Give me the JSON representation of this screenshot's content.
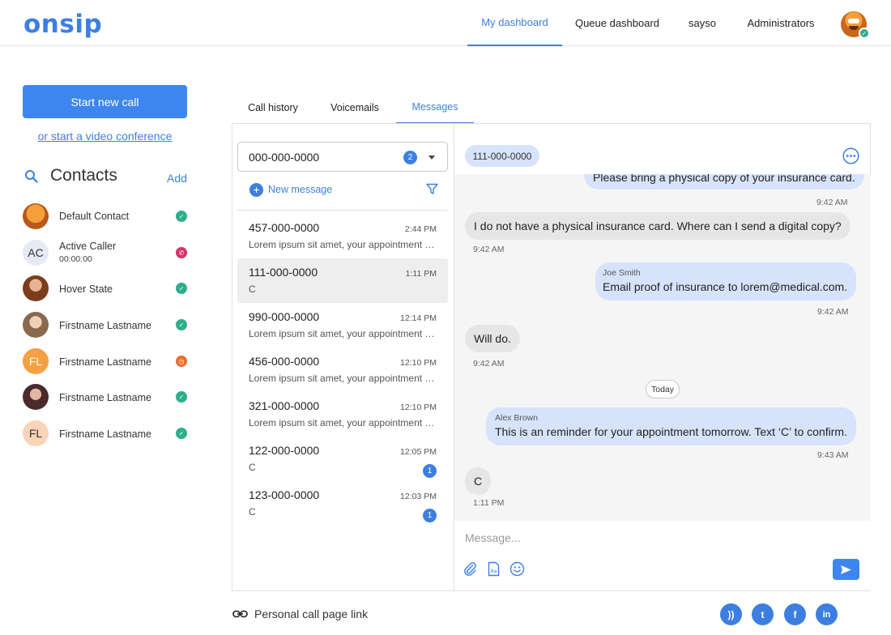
{
  "brand": {
    "logo_text": "onsip",
    "accent": "#3d7fe0"
  },
  "header": {
    "nav": [
      {
        "label": "My dashboard",
        "active": true
      },
      {
        "label": "Queue dashboard",
        "active": false
      },
      {
        "label": "sayso",
        "active": false
      },
      {
        "label": "Administrators",
        "active": false
      }
    ],
    "avatar_status": "available"
  },
  "sidebar": {
    "start_call_label": "Start new call",
    "video_conference_label": "or start a video conference",
    "contacts_title": "Contacts",
    "add_label": "Add",
    "contacts": [
      {
        "name": "Default Contact",
        "sub": "",
        "initials": "",
        "status": "available"
      },
      {
        "name": "Active Caller",
        "sub": "00:00:00",
        "initials": "AC",
        "status": "on-call"
      },
      {
        "name": "Hover State",
        "sub": "",
        "initials": "",
        "status": "available"
      },
      {
        "name": "Firstname Lastname",
        "sub": "",
        "initials": "",
        "status": "available"
      },
      {
        "name": "Firstname Lastname",
        "sub": "",
        "initials": "FL",
        "status": "away"
      },
      {
        "name": "Firstname Lastname",
        "sub": "",
        "initials": "",
        "status": "available"
      },
      {
        "name": "Firstname Lastname",
        "sub": "",
        "initials": "FL",
        "status": "available"
      }
    ]
  },
  "tabs": [
    {
      "label": "Call history",
      "active": false
    },
    {
      "label": "Voicemails",
      "active": false
    },
    {
      "label": "Messages",
      "active": true
    }
  ],
  "messages_panel": {
    "line_select": {
      "value": "000-000-0000",
      "count": "2"
    },
    "new_message_label": "New message",
    "conversations": [
      {
        "number": "457-000-0000",
        "time": "2:44 PM",
        "preview": "Lorem ipsum sit amet, your appointment is confirmed",
        "unread": ""
      },
      {
        "number": "111-000-0000",
        "time": "1:11 PM",
        "preview": "C",
        "unread": "",
        "selected": true
      },
      {
        "number": "990-000-0000",
        "time": "12:14 PM",
        "preview": "Lorem ipsum sit amet, your appointment is confirmed",
        "unread": ""
      },
      {
        "number": "456-000-0000",
        "time": "12:10 PM",
        "preview": "Lorem ipsum sit amet, your appointment is confirmed",
        "unread": ""
      },
      {
        "number": "321-000-0000",
        "time": "12:10 PM",
        "preview": "Lorem ipsum sit amet, your appointment is confirmed",
        "unread": ""
      },
      {
        "number": "122-000-0000",
        "time": "12:05 PM",
        "preview": "C",
        "unread": "1"
      },
      {
        "number": "123-000-0000",
        "time": "12:03 PM",
        "preview": "C",
        "unread": "1"
      }
    ]
  },
  "chat": {
    "contact_chip": "111-000-0000",
    "thread": [
      {
        "dir": "out",
        "sender": "",
        "text": "Please bring a physical copy of your insurance card.",
        "time": "9:42 AM"
      },
      {
        "dir": "in",
        "sender": "",
        "text": "I do not have a physical insurance card. Where can I send a digital copy?",
        "time": "9:42 AM"
      },
      {
        "dir": "out",
        "sender": "Joe Smith",
        "text": "Email proof of insurance to lorem@medical.com.",
        "time": "9:42 AM"
      },
      {
        "dir": "in",
        "sender": "",
        "text": "Will do.",
        "time": "9:42 AM"
      },
      {
        "dir": "out",
        "sender": "Alex Brown",
        "text": "This is an reminder for your appointment tomorrow. Text ‘C’ to confirm.",
        "time": "9:43 AM"
      },
      {
        "dir": "in",
        "sender": "",
        "text": "C",
        "time": "1:11 PM"
      }
    ],
    "day_separator": "Today",
    "composer_placeholder": "Message..."
  },
  "footer": {
    "personal_link_label": "Personal call page link",
    "social": [
      "rss-icon",
      "twitter-icon",
      "facebook-icon",
      "linkedin-icon"
    ],
    "social_glyphs": [
      "))",
      "t",
      "f",
      "in"
    ]
  }
}
